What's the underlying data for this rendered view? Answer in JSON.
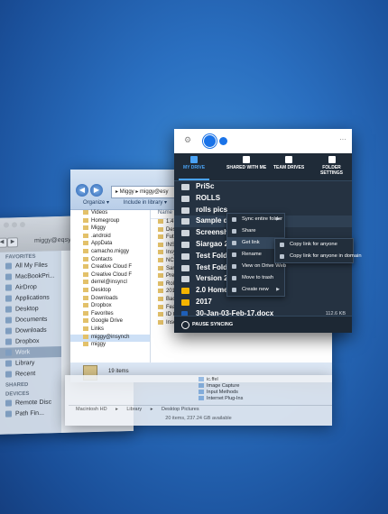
{
  "mac_finder": {
    "title": "miggy@eqsyo",
    "favorites_label": "FAVORITES",
    "favorites": [
      "All My Files",
      "MacBookPri...",
      "AirDrop",
      "Applications",
      "Desktop",
      "Documents",
      "Downloads",
      "Dropbox",
      "Work",
      "Library",
      "Recent"
    ],
    "shared_label": "SHARED",
    "devices_label": "DEVICES",
    "devices": [
      "Remote Disc",
      "Path Fin..."
    ]
  },
  "explorer": {
    "address": "▸ Miggy ▸ miggy@esy",
    "commands": [
      "Organize ▾",
      "Include in library ▾"
    ],
    "tree": [
      "Videos",
      "Homegroup",
      "Miggy",
      ".android",
      "AppData",
      "camacho.miggy",
      "Contacts",
      "Creative Cloud F",
      "Creative Cloud F",
      "derrel@insyncl",
      "Desktop",
      "Downloads",
      "Dropbox",
      "Favorites",
      "Google Drive",
      "Links",
      "miggy@insynch",
      "miggy"
    ],
    "list_header": "Name",
    "list": [
      "1.4 inb...",
      "Design",
      "Future",
      "INSYN",
      "Insync",
      "NCR",
      "Sargas",
      "Presm",
      "RollJD",
      "2017",
      "Backup",
      "Featur",
      "ID Car",
      "Inserts"
    ],
    "status": "19 items"
  },
  "column_window": {
    "items": [
      "ic.ffel",
      "Image Capture",
      "Input Methods",
      "Internet Plug-Ins"
    ],
    "path": [
      "Macintosh HD",
      "Library",
      "Desktop Pictures"
    ],
    "status": "20 items, 237.24 GB available"
  },
  "drive": {
    "tabs": [
      {
        "label": "MY DRIVE",
        "icon": "my-drive-icon",
        "active": true
      },
      {
        "label": "SHARED WITH ME",
        "icon": "shared-icon",
        "active": false
      },
      {
        "label": "TEAM DRIVES",
        "icon": "team-drives-icon",
        "active": false
      },
      {
        "label": "FOLDER SETTINGS",
        "icon": "gear-icon",
        "active": false
      }
    ],
    "rows": [
      {
        "name": "PriSc",
        "kind": "folder",
        "size": ""
      },
      {
        "name": "ROLLS",
        "kind": "folder",
        "size": ""
      },
      {
        "name": "rolls pics",
        "kind": "folder",
        "size": ""
      },
      {
        "name": "Sample dir",
        "kind": "folder",
        "size": ""
      },
      {
        "name": "Screensho",
        "kind": "folder",
        "size": ""
      },
      {
        "name": "Siargao 20",
        "kind": "folder",
        "size": ""
      },
      {
        "name": "Test Folde",
        "kind": "folder",
        "size": ""
      },
      {
        "name": "Test Folde",
        "kind": "folder",
        "size": ""
      },
      {
        "name": "Version 2.0",
        "kind": "folder",
        "size": ""
      },
      {
        "name": "2.0 Homepage copy",
        "kind": "slides",
        "size": ""
      },
      {
        "name": "2017",
        "kind": "slides",
        "size": ""
      },
      {
        "name": "30-Jan-03-Feb-17.docx",
        "kind": "word",
        "size": "112.6 KB"
      }
    ],
    "pause_label": "PAUSE SYNCING",
    "context_menu": [
      "Sync entire folder",
      "Share",
      "Get link",
      "Rename",
      "View on Drive Web",
      "Move to trash",
      "Create new"
    ],
    "submenu": [
      "Copy link for anyone",
      "Copy link for anyone in domain"
    ]
  }
}
